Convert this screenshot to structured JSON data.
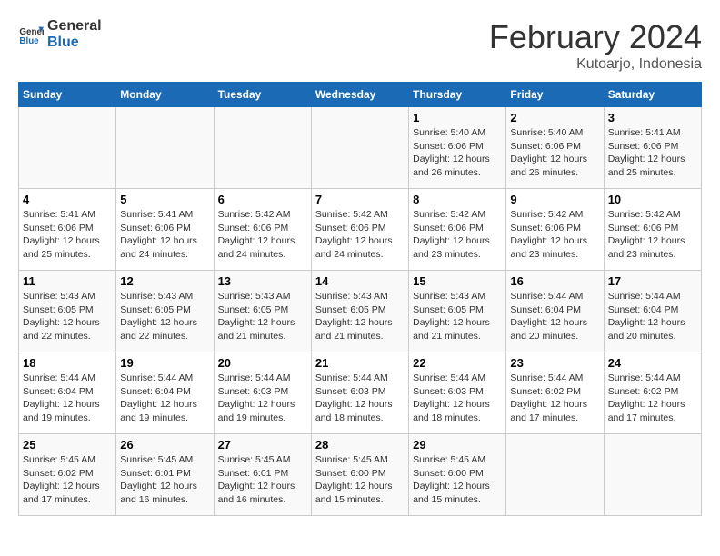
{
  "header": {
    "logo_line1": "General",
    "logo_line2": "Blue",
    "month_year": "February 2024",
    "location": "Kutoarjo, Indonesia"
  },
  "weekdays": [
    "Sunday",
    "Monday",
    "Tuesday",
    "Wednesday",
    "Thursday",
    "Friday",
    "Saturday"
  ],
  "weeks": [
    [
      {
        "day": "",
        "info": ""
      },
      {
        "day": "",
        "info": ""
      },
      {
        "day": "",
        "info": ""
      },
      {
        "day": "",
        "info": ""
      },
      {
        "day": "1",
        "info": "Sunrise: 5:40 AM\nSunset: 6:06 PM\nDaylight: 12 hours\nand 26 minutes."
      },
      {
        "day": "2",
        "info": "Sunrise: 5:40 AM\nSunset: 6:06 PM\nDaylight: 12 hours\nand 26 minutes."
      },
      {
        "day": "3",
        "info": "Sunrise: 5:41 AM\nSunset: 6:06 PM\nDaylight: 12 hours\nand 25 minutes."
      }
    ],
    [
      {
        "day": "4",
        "info": "Sunrise: 5:41 AM\nSunset: 6:06 PM\nDaylight: 12 hours\nand 25 minutes."
      },
      {
        "day": "5",
        "info": "Sunrise: 5:41 AM\nSunset: 6:06 PM\nDaylight: 12 hours\nand 24 minutes."
      },
      {
        "day": "6",
        "info": "Sunrise: 5:42 AM\nSunset: 6:06 PM\nDaylight: 12 hours\nand 24 minutes."
      },
      {
        "day": "7",
        "info": "Sunrise: 5:42 AM\nSunset: 6:06 PM\nDaylight: 12 hours\nand 24 minutes."
      },
      {
        "day": "8",
        "info": "Sunrise: 5:42 AM\nSunset: 6:06 PM\nDaylight: 12 hours\nand 23 minutes."
      },
      {
        "day": "9",
        "info": "Sunrise: 5:42 AM\nSunset: 6:06 PM\nDaylight: 12 hours\nand 23 minutes."
      },
      {
        "day": "10",
        "info": "Sunrise: 5:42 AM\nSunset: 6:06 PM\nDaylight: 12 hours\nand 23 minutes."
      }
    ],
    [
      {
        "day": "11",
        "info": "Sunrise: 5:43 AM\nSunset: 6:05 PM\nDaylight: 12 hours\nand 22 minutes."
      },
      {
        "day": "12",
        "info": "Sunrise: 5:43 AM\nSunset: 6:05 PM\nDaylight: 12 hours\nand 22 minutes."
      },
      {
        "day": "13",
        "info": "Sunrise: 5:43 AM\nSunset: 6:05 PM\nDaylight: 12 hours\nand 21 minutes."
      },
      {
        "day": "14",
        "info": "Sunrise: 5:43 AM\nSunset: 6:05 PM\nDaylight: 12 hours\nand 21 minutes."
      },
      {
        "day": "15",
        "info": "Sunrise: 5:43 AM\nSunset: 6:05 PM\nDaylight: 12 hours\nand 21 minutes."
      },
      {
        "day": "16",
        "info": "Sunrise: 5:44 AM\nSunset: 6:04 PM\nDaylight: 12 hours\nand 20 minutes."
      },
      {
        "day": "17",
        "info": "Sunrise: 5:44 AM\nSunset: 6:04 PM\nDaylight: 12 hours\nand 20 minutes."
      }
    ],
    [
      {
        "day": "18",
        "info": "Sunrise: 5:44 AM\nSunset: 6:04 PM\nDaylight: 12 hours\nand 19 minutes."
      },
      {
        "day": "19",
        "info": "Sunrise: 5:44 AM\nSunset: 6:04 PM\nDaylight: 12 hours\nand 19 minutes."
      },
      {
        "day": "20",
        "info": "Sunrise: 5:44 AM\nSunset: 6:03 PM\nDaylight: 12 hours\nand 19 minutes."
      },
      {
        "day": "21",
        "info": "Sunrise: 5:44 AM\nSunset: 6:03 PM\nDaylight: 12 hours\nand 18 minutes."
      },
      {
        "day": "22",
        "info": "Sunrise: 5:44 AM\nSunset: 6:03 PM\nDaylight: 12 hours\nand 18 minutes."
      },
      {
        "day": "23",
        "info": "Sunrise: 5:44 AM\nSunset: 6:02 PM\nDaylight: 12 hours\nand 17 minutes."
      },
      {
        "day": "24",
        "info": "Sunrise: 5:44 AM\nSunset: 6:02 PM\nDaylight: 12 hours\nand 17 minutes."
      }
    ],
    [
      {
        "day": "25",
        "info": "Sunrise: 5:45 AM\nSunset: 6:02 PM\nDaylight: 12 hours\nand 17 minutes."
      },
      {
        "day": "26",
        "info": "Sunrise: 5:45 AM\nSunset: 6:01 PM\nDaylight: 12 hours\nand 16 minutes."
      },
      {
        "day": "27",
        "info": "Sunrise: 5:45 AM\nSunset: 6:01 PM\nDaylight: 12 hours\nand 16 minutes."
      },
      {
        "day": "28",
        "info": "Sunrise: 5:45 AM\nSunset: 6:00 PM\nDaylight: 12 hours\nand 15 minutes."
      },
      {
        "day": "29",
        "info": "Sunrise: 5:45 AM\nSunset: 6:00 PM\nDaylight: 12 hours\nand 15 minutes."
      },
      {
        "day": "",
        "info": ""
      },
      {
        "day": "",
        "info": ""
      }
    ]
  ]
}
